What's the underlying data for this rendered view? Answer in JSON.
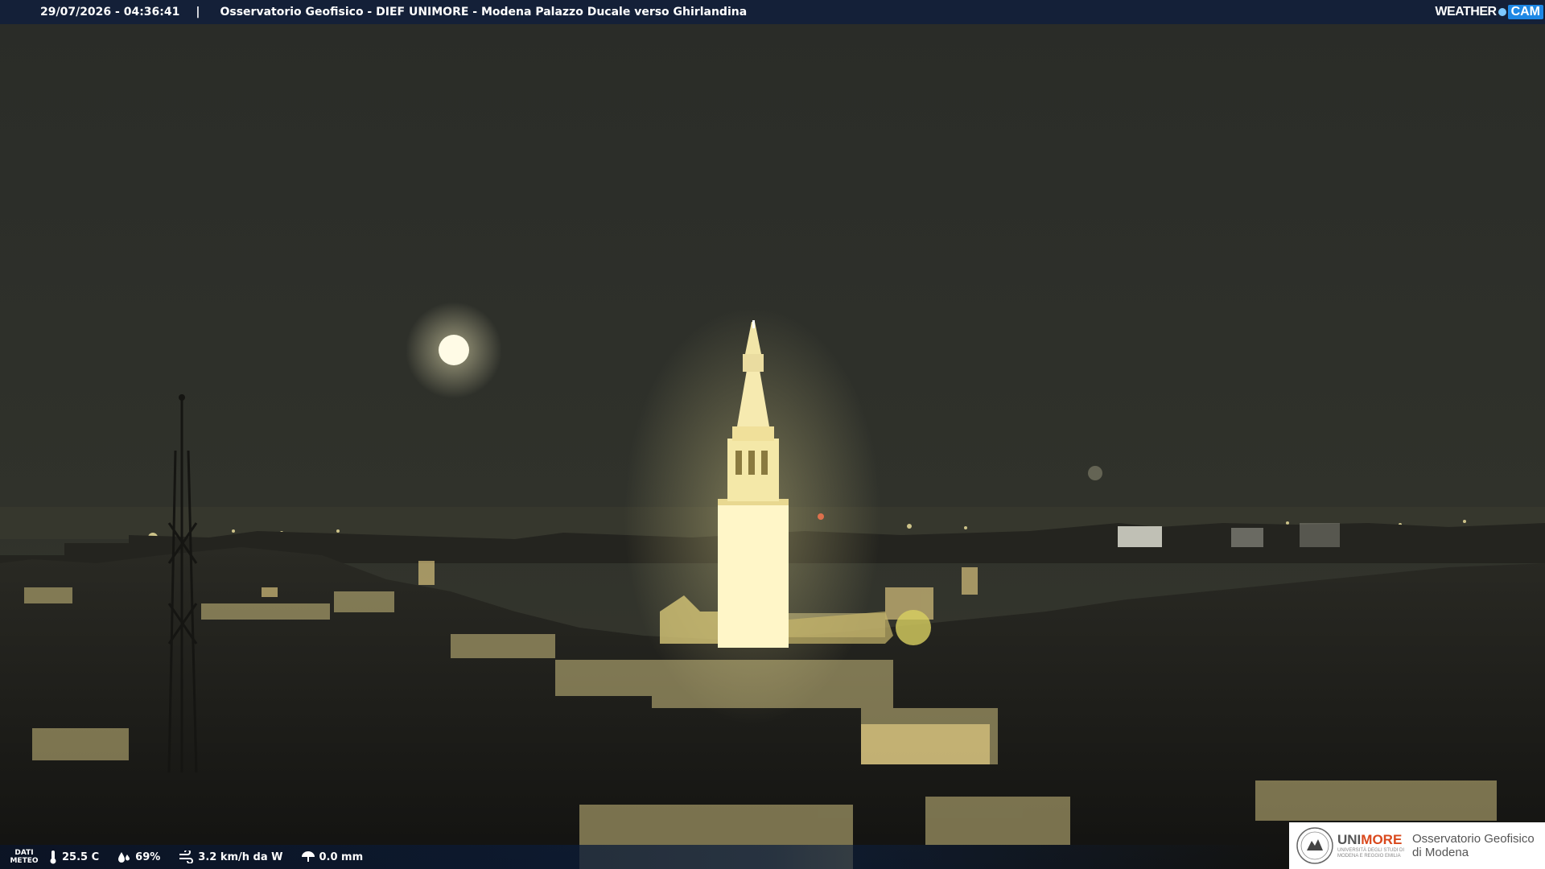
{
  "header": {
    "timestamp": "29/07/2026 - 04:36:41",
    "separator": "|",
    "title": "Osservatorio Geofisico - DIEF UNIMORE - Modena Palazzo Ducale verso Ghirlandina",
    "logo_weather": "WEATHER",
    "logo_cam": "CAM"
  },
  "meteo": {
    "label_line1": "DATI",
    "label_line2": "METEO",
    "temperature": "25.5 C",
    "humidity": "69%",
    "wind": "3.2 km/h da W",
    "rain": "0.0 mm"
  },
  "branding": {
    "uni": "UNI",
    "more": "MORE",
    "uni_sub_1": "UNIVERSITÀ DEGLI STUDI DI",
    "uni_sub_2": "MODENA E REGGIO EMILIA",
    "obs_line1": "Osservatorio Geofisico",
    "obs_line2": "di Modena"
  },
  "colors": {
    "sky": "#2b2d27",
    "tower_light": "#fff4c0",
    "moon": "#fffbe6",
    "bar": "#12203a",
    "accent": "#d9481c"
  }
}
